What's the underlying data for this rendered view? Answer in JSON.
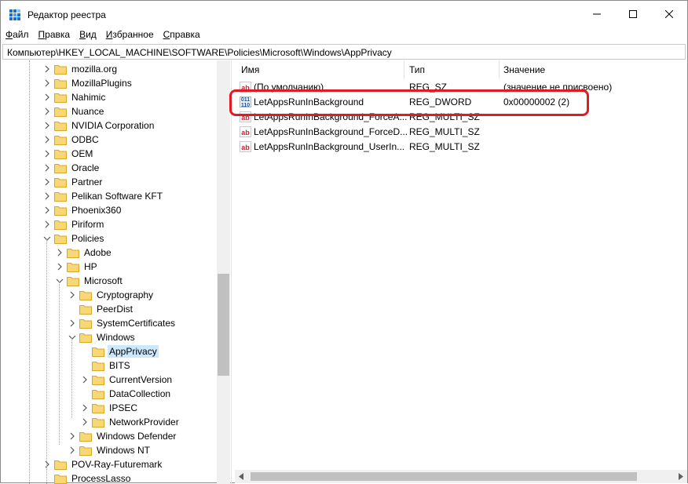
{
  "window": {
    "title": "Редактор реестра",
    "minimize": "—",
    "maximize": "☐",
    "close": "✕"
  },
  "menu": [
    {
      "label": "Файл",
      "u": "Ф",
      "rest": "айл"
    },
    {
      "label": "Правка",
      "u": "П",
      "rest": "равка"
    },
    {
      "label": "Вид",
      "u": "В",
      "rest": "ид"
    },
    {
      "label": "Избранное",
      "u": "И",
      "rest": "збранное"
    },
    {
      "label": "Справка",
      "u": "С",
      "rest": "правка"
    }
  ],
  "address": "Компьютер\\HKEY_LOCAL_MACHINE\\SOFTWARE\\Policies\\Microsoft\\Windows\\AppPrivacy",
  "tree": [
    {
      "label": "mozilla.org",
      "level": 0,
      "chev": "right"
    },
    {
      "label": "MozillaPlugins",
      "level": 0,
      "chev": "right"
    },
    {
      "label": "Nahimic",
      "level": 0,
      "chev": "right"
    },
    {
      "label": "Nuance",
      "level": 0,
      "chev": "right"
    },
    {
      "label": "NVIDIA Corporation",
      "level": 0,
      "chev": "right"
    },
    {
      "label": "ODBC",
      "level": 0,
      "chev": "right"
    },
    {
      "label": "OEM",
      "level": 0,
      "chev": "right"
    },
    {
      "label": "Oracle",
      "level": 0,
      "chev": "right"
    },
    {
      "label": "Partner",
      "level": 0,
      "chev": "right"
    },
    {
      "label": "Pelikan Software KFT",
      "level": 0,
      "chev": "right"
    },
    {
      "label": "Phoenix360",
      "level": 0,
      "chev": "right"
    },
    {
      "label": "Piriform",
      "level": 0,
      "chev": "right"
    },
    {
      "label": "Policies",
      "level": 0,
      "chev": "down"
    },
    {
      "label": "Adobe",
      "level": 1,
      "chev": "right"
    },
    {
      "label": "HP",
      "level": 1,
      "chev": "right"
    },
    {
      "label": "Microsoft",
      "level": 1,
      "chev": "down"
    },
    {
      "label": "Cryptography",
      "level": 2,
      "chev": "right"
    },
    {
      "label": "PeerDist",
      "level": 2,
      "chev": "none"
    },
    {
      "label": "SystemCertificates",
      "level": 2,
      "chev": "right"
    },
    {
      "label": "Windows",
      "level": 2,
      "chev": "down"
    },
    {
      "label": "AppPrivacy",
      "level": 3,
      "chev": "none",
      "selected": true
    },
    {
      "label": "BITS",
      "level": 3,
      "chev": "none"
    },
    {
      "label": "CurrentVersion",
      "level": 3,
      "chev": "right"
    },
    {
      "label": "DataCollection",
      "level": 3,
      "chev": "none"
    },
    {
      "label": "IPSEC",
      "level": 3,
      "chev": "right"
    },
    {
      "label": "NetworkProvider",
      "level": 3,
      "chev": "right"
    },
    {
      "label": "Windows Defender",
      "level": 2,
      "chev": "right"
    },
    {
      "label": "Windows NT",
      "level": 2,
      "chev": "right"
    },
    {
      "label": "POV-Ray-Futuremark",
      "level": 0,
      "chev": "right"
    },
    {
      "label": "ProcessLasso",
      "level": 0,
      "chev": "none"
    }
  ],
  "columns": {
    "name": "Имя",
    "type": "Тип",
    "data": "Значение"
  },
  "values": [
    {
      "name": "(По умолчанию)",
      "type": "REG_SZ",
      "data": "(значение не присвоено)",
      "icon": "ab"
    },
    {
      "name": "LetAppsRunInBackground",
      "type": "REG_DWORD",
      "data": "0x00000002 (2)",
      "icon": "bin"
    },
    {
      "name": "LetAppsRunInBackground_ForceA...",
      "type": "REG_MULTI_SZ",
      "data": "",
      "icon": "ab"
    },
    {
      "name": "LetAppsRunInBackground_ForceD...",
      "type": "REG_MULTI_SZ",
      "data": "",
      "icon": "ab"
    },
    {
      "name": "LetAppsRunInBackground_UserIn...",
      "type": "REG_MULTI_SZ",
      "data": "",
      "icon": "ab"
    }
  ],
  "colors": {
    "highlight": "#e01b24",
    "selection": "#cce8ff",
    "folder": "#f8d775",
    "folder_edge": "#d9a72b"
  }
}
